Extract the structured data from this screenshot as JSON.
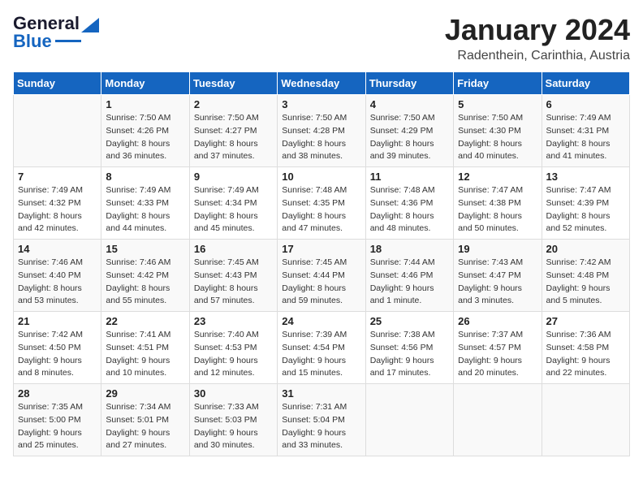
{
  "header": {
    "logo_line1": "General",
    "logo_line2": "Blue",
    "month": "January 2024",
    "location": "Radenthein, Carinthia, Austria"
  },
  "columns": [
    "Sunday",
    "Monday",
    "Tuesday",
    "Wednesday",
    "Thursday",
    "Friday",
    "Saturday"
  ],
  "weeks": [
    [
      {
        "day": "",
        "info": ""
      },
      {
        "day": "1",
        "info": "Sunrise: 7:50 AM\nSunset: 4:26 PM\nDaylight: 8 hours\nand 36 minutes."
      },
      {
        "day": "2",
        "info": "Sunrise: 7:50 AM\nSunset: 4:27 PM\nDaylight: 8 hours\nand 37 minutes."
      },
      {
        "day": "3",
        "info": "Sunrise: 7:50 AM\nSunset: 4:28 PM\nDaylight: 8 hours\nand 38 minutes."
      },
      {
        "day": "4",
        "info": "Sunrise: 7:50 AM\nSunset: 4:29 PM\nDaylight: 8 hours\nand 39 minutes."
      },
      {
        "day": "5",
        "info": "Sunrise: 7:50 AM\nSunset: 4:30 PM\nDaylight: 8 hours\nand 40 minutes."
      },
      {
        "day": "6",
        "info": "Sunrise: 7:49 AM\nSunset: 4:31 PM\nDaylight: 8 hours\nand 41 minutes."
      }
    ],
    [
      {
        "day": "7",
        "info": "Sunrise: 7:49 AM\nSunset: 4:32 PM\nDaylight: 8 hours\nand 42 minutes."
      },
      {
        "day": "8",
        "info": "Sunrise: 7:49 AM\nSunset: 4:33 PM\nDaylight: 8 hours\nand 44 minutes."
      },
      {
        "day": "9",
        "info": "Sunrise: 7:49 AM\nSunset: 4:34 PM\nDaylight: 8 hours\nand 45 minutes."
      },
      {
        "day": "10",
        "info": "Sunrise: 7:48 AM\nSunset: 4:35 PM\nDaylight: 8 hours\nand 47 minutes."
      },
      {
        "day": "11",
        "info": "Sunrise: 7:48 AM\nSunset: 4:36 PM\nDaylight: 8 hours\nand 48 minutes."
      },
      {
        "day": "12",
        "info": "Sunrise: 7:47 AM\nSunset: 4:38 PM\nDaylight: 8 hours\nand 50 minutes."
      },
      {
        "day": "13",
        "info": "Sunrise: 7:47 AM\nSunset: 4:39 PM\nDaylight: 8 hours\nand 52 minutes."
      }
    ],
    [
      {
        "day": "14",
        "info": "Sunrise: 7:46 AM\nSunset: 4:40 PM\nDaylight: 8 hours\nand 53 minutes."
      },
      {
        "day": "15",
        "info": "Sunrise: 7:46 AM\nSunset: 4:42 PM\nDaylight: 8 hours\nand 55 minutes."
      },
      {
        "day": "16",
        "info": "Sunrise: 7:45 AM\nSunset: 4:43 PM\nDaylight: 8 hours\nand 57 minutes."
      },
      {
        "day": "17",
        "info": "Sunrise: 7:45 AM\nSunset: 4:44 PM\nDaylight: 8 hours\nand 59 minutes."
      },
      {
        "day": "18",
        "info": "Sunrise: 7:44 AM\nSunset: 4:46 PM\nDaylight: 9 hours\nand 1 minute."
      },
      {
        "day": "19",
        "info": "Sunrise: 7:43 AM\nSunset: 4:47 PM\nDaylight: 9 hours\nand 3 minutes."
      },
      {
        "day": "20",
        "info": "Sunrise: 7:42 AM\nSunset: 4:48 PM\nDaylight: 9 hours\nand 5 minutes."
      }
    ],
    [
      {
        "day": "21",
        "info": "Sunrise: 7:42 AM\nSunset: 4:50 PM\nDaylight: 9 hours\nand 8 minutes."
      },
      {
        "day": "22",
        "info": "Sunrise: 7:41 AM\nSunset: 4:51 PM\nDaylight: 9 hours\nand 10 minutes."
      },
      {
        "day": "23",
        "info": "Sunrise: 7:40 AM\nSunset: 4:53 PM\nDaylight: 9 hours\nand 12 minutes."
      },
      {
        "day": "24",
        "info": "Sunrise: 7:39 AM\nSunset: 4:54 PM\nDaylight: 9 hours\nand 15 minutes."
      },
      {
        "day": "25",
        "info": "Sunrise: 7:38 AM\nSunset: 4:56 PM\nDaylight: 9 hours\nand 17 minutes."
      },
      {
        "day": "26",
        "info": "Sunrise: 7:37 AM\nSunset: 4:57 PM\nDaylight: 9 hours\nand 20 minutes."
      },
      {
        "day": "27",
        "info": "Sunrise: 7:36 AM\nSunset: 4:58 PM\nDaylight: 9 hours\nand 22 minutes."
      }
    ],
    [
      {
        "day": "28",
        "info": "Sunrise: 7:35 AM\nSunset: 5:00 PM\nDaylight: 9 hours\nand 25 minutes."
      },
      {
        "day": "29",
        "info": "Sunrise: 7:34 AM\nSunset: 5:01 PM\nDaylight: 9 hours\nand 27 minutes."
      },
      {
        "day": "30",
        "info": "Sunrise: 7:33 AM\nSunset: 5:03 PM\nDaylight: 9 hours\nand 30 minutes."
      },
      {
        "day": "31",
        "info": "Sunrise: 7:31 AM\nSunset: 5:04 PM\nDaylight: 9 hours\nand 33 minutes."
      },
      {
        "day": "",
        "info": ""
      },
      {
        "day": "",
        "info": ""
      },
      {
        "day": "",
        "info": ""
      }
    ]
  ]
}
